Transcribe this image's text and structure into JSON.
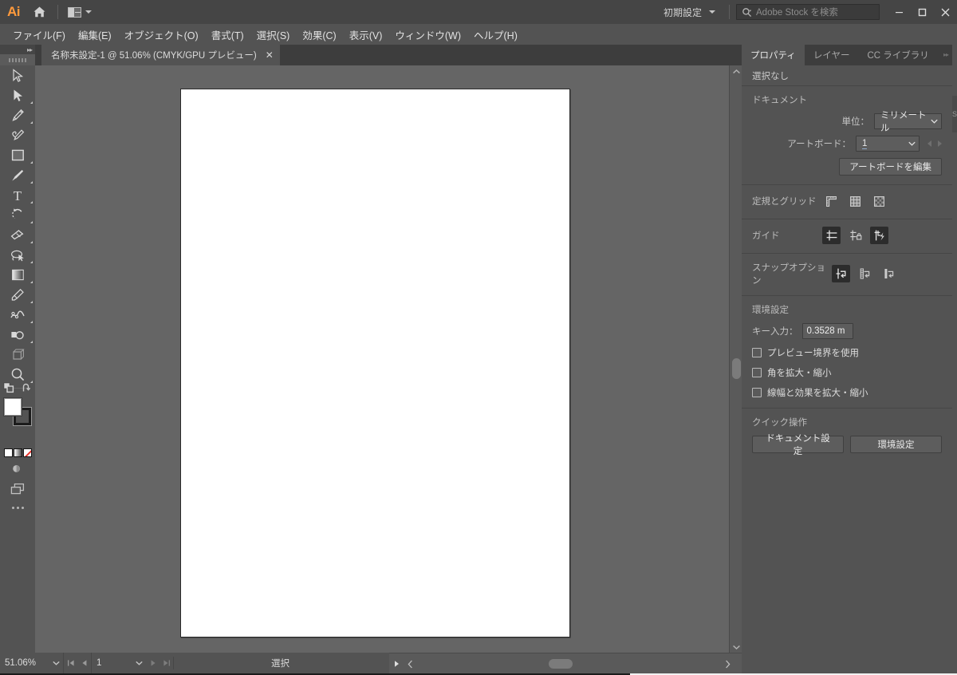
{
  "app": {
    "name": "Adobe Illustrator",
    "logo_text": "Ai",
    "logo_color": "#ff9a3c"
  },
  "titlebar": {
    "home_icon": "home-icon",
    "arrange_icon": "arrange-documents-icon",
    "arrange_chevron": "chevron-down-icon",
    "workspace": {
      "label": "初期設定",
      "chevron": "chevron-down-icon"
    },
    "stock_search": {
      "icon": "search-icon",
      "placeholder": "Adobe Stock を検索",
      "value": ""
    },
    "window_buttons": [
      {
        "name": "minimize-button",
        "glyph": "—"
      },
      {
        "name": "maximize-button",
        "glyph": "❐"
      },
      {
        "name": "close-button",
        "glyph": "✕"
      }
    ]
  },
  "menubar": {
    "items": [
      {
        "label": "ファイル(F)"
      },
      {
        "label": "編集(E)"
      },
      {
        "label": "オブジェクト(O)"
      },
      {
        "label": "書式(T)"
      },
      {
        "label": "選択(S)"
      },
      {
        "label": "効果(C)"
      },
      {
        "label": "表示(V)"
      },
      {
        "label": "ウィンドウ(W)"
      },
      {
        "label": "ヘルプ(H)"
      }
    ]
  },
  "document_tab": {
    "title": "名称未設定-1 @ 51.06% (CMYK/GPU プレビュー)",
    "close_glyph": "✕"
  },
  "toolpanel": {
    "collapse_glyph": "▸▸",
    "tools": [
      {
        "name": "selection-tool",
        "icon": "selection-arrow-icon",
        "selected": false,
        "has_flyout": false
      },
      {
        "name": "direct-selection-tool",
        "icon": "direct-selection-icon",
        "selected": false,
        "has_flyout": true
      },
      {
        "name": "pen-tool",
        "icon": "pen-icon",
        "selected": false,
        "has_flyout": true
      },
      {
        "name": "curvature-tool",
        "icon": "curvature-pen-icon",
        "selected": false,
        "has_flyout": false
      },
      {
        "name": "rectangle-tool",
        "icon": "rectangle-icon",
        "selected": false,
        "has_flyout": true
      },
      {
        "name": "paintbrush-tool",
        "icon": "paintbrush-icon",
        "selected": false,
        "has_flyout": true
      },
      {
        "name": "type-tool",
        "icon": "type-t-icon",
        "selected": false,
        "has_flyout": true
      },
      {
        "name": "rotate-tool",
        "icon": "rotate-icon",
        "selected": false,
        "has_flyout": true
      },
      {
        "name": "eraser-tool",
        "icon": "eraser-icon",
        "selected": false,
        "has_flyout": true
      },
      {
        "name": "lasso-scale-tool",
        "icon": "lasso-icon",
        "selected": false,
        "has_flyout": true
      },
      {
        "name": "gradient-tool",
        "icon": "gradient-icon",
        "selected": false,
        "has_flyout": true
      },
      {
        "name": "eyedropper-tool",
        "icon": "eyedropper-icon",
        "selected": false,
        "has_flyout": true
      },
      {
        "name": "blend-tool",
        "icon": "blend-icon",
        "selected": false,
        "has_flyout": true
      },
      {
        "name": "shape-builder-tool",
        "icon": "shape-builder-icon",
        "selected": false,
        "has_flyout": true
      },
      {
        "name": "free-transform-tool",
        "icon": "free-transform-icon",
        "selected": false,
        "has_flyout": false
      },
      {
        "name": "zoom-tool",
        "icon": "magnifier-icon",
        "selected": false,
        "has_flyout": true
      }
    ],
    "swatch_tools": {
      "swap_icon": "swap-fill-stroke-icon",
      "default_icon": "default-fill-stroke-icon",
      "fill_color": "#ffffff",
      "stroke_color": "#000000"
    },
    "color_modes": [
      {
        "name": "flat-color-button",
        "icon": "flat-color-icon"
      },
      {
        "name": "gradient-color-button",
        "icon": "gradient-color-icon"
      },
      {
        "name": "no-color-button",
        "icon": "none-color-icon"
      }
    ],
    "drawing_mode": {
      "name": "drawing-mode-button",
      "icon": "draw-normal-icon"
    },
    "screen_mode": {
      "name": "screen-mode-button",
      "icon": "screen-mode-icon"
    },
    "more_tools": {
      "name": "edit-toolbar-button",
      "icon": "ellipsis-icon"
    }
  },
  "canvas": {
    "artboard_fill": "#ffffff",
    "background": "#656565"
  },
  "statusbar": {
    "zoom_value": "51.06%",
    "zoom_chevron": "chevron-down-icon",
    "first_artboard_icon": "first-artboard-icon",
    "prev_artboard_icon": "prev-artboard-icon",
    "artboard_number": "1",
    "artboard_chevron": "chevron-down-icon",
    "next_artboard_icon": "next-artboard-icon",
    "last_artboard_icon": "last-artboard-icon",
    "status_text": "選択",
    "status_menu_icon": "play-triangle-icon",
    "scroll_left_icon": "scroll-left-icon",
    "scroll_right_icon": "scroll-right-icon"
  },
  "properties_panel": {
    "collapse_glyph": "▸▸",
    "tabs": [
      {
        "label": "プロパティ",
        "active": true
      },
      {
        "label": "レイヤー",
        "active": false
      },
      {
        "label": "CC ライブラリ",
        "active": false
      }
    ],
    "selection_status": "選択なし",
    "document": {
      "heading": "ドキュメント",
      "unit_label": "単位：",
      "unit_value": "ミリメートル",
      "unit_chevron": "chevron-down-icon",
      "artboard_label": "アートボード：",
      "artboard_value": "1",
      "artboard_chevron": "chevron-down-icon",
      "prev_icon": "prev-arrow-icon",
      "next_icon": "next-arrow-icon",
      "edit_artboard_button": "アートボードを編集"
    },
    "rulers_grid": {
      "label": "定規とグリッド",
      "buttons": [
        {
          "name": "show-rulers-button",
          "icon": "ruler-icon",
          "active": false
        },
        {
          "name": "show-grid-button",
          "icon": "grid-icon",
          "active": false
        },
        {
          "name": "show-transparency-grid-button",
          "icon": "transparency-grid-icon",
          "active": false
        }
      ]
    },
    "guides": {
      "label": "ガイド",
      "buttons": [
        {
          "name": "show-guides-button",
          "icon": "guides-icon",
          "active": true
        },
        {
          "name": "lock-guides-button",
          "icon": "lock-guides-icon",
          "active": false
        },
        {
          "name": "smart-guides-button",
          "icon": "smart-guides-icon",
          "active": true
        }
      ]
    },
    "snap_options": {
      "label": "スナップオプション",
      "buttons": [
        {
          "name": "snap-to-point-button",
          "icon": "snap-to-point-icon",
          "active": true
        },
        {
          "name": "snap-to-grid-button",
          "icon": "snap-to-grid-icon",
          "active": false
        },
        {
          "name": "snap-to-pixel-button",
          "icon": "snap-to-pixel-icon",
          "active": false
        }
      ]
    },
    "preferences": {
      "heading": "環境設定",
      "key_input_label": "キー入力：",
      "key_input_value": "0.3528 m",
      "checkboxes": [
        {
          "label": "プレビュー境界を使用",
          "checked": false,
          "name": "use-preview-bounds-checkbox"
        },
        {
          "label": "角を拡大・縮小",
          "checked": false,
          "name": "scale-corners-checkbox"
        },
        {
          "label": "線幅と効果を拡大・縮小",
          "checked": false,
          "name": "scale-strokes-effects-checkbox"
        }
      ]
    },
    "quick_actions": {
      "heading": "クイック操作",
      "buttons": [
        {
          "label": "ドキュメント設定",
          "name": "document-setup-button"
        },
        {
          "label": "環境設定",
          "name": "preferences-button"
        }
      ]
    }
  },
  "stock_panel_edge": {
    "label": "S"
  }
}
